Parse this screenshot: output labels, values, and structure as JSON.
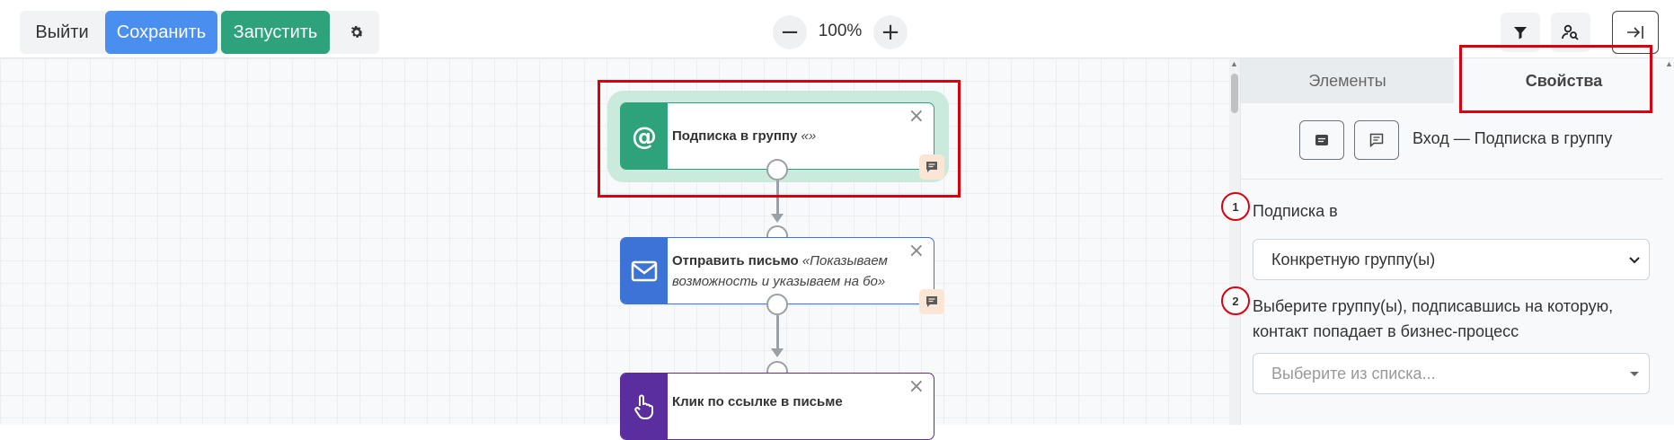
{
  "toolbar": {
    "exit_label": "Выйти",
    "save_label": "Сохранить",
    "run_label": "Запустить",
    "zoom_minus": "−",
    "zoom_plus": "+",
    "zoom_level": "100%"
  },
  "nodes": [
    {
      "title": "Подписка в группу",
      "subtitle": "«»",
      "icon": "at-icon",
      "color": "#2ea27a"
    },
    {
      "title": "Отправить письмо",
      "subtitle": "«Показываем возможность и указываем на бо»",
      "icon": "envelope-icon",
      "color": "#3d72d6"
    },
    {
      "title": "Клик по ссылке в письме",
      "subtitle": "",
      "icon": "pointer-hand-icon",
      "color": "#5b2ea0"
    }
  ],
  "panel": {
    "tabs": [
      {
        "label": "Элементы"
      },
      {
        "label": "Свойства"
      }
    ],
    "title": "Вход — Подписка в группу",
    "fields": [
      {
        "number": "1",
        "label": "Подписка в",
        "value": "Конкретную группу(ы)"
      },
      {
        "number": "2",
        "label": "Выберите группу(ы), подписавшись на которую, контакт попадает в бизнес-процесс",
        "placeholder": "Выберите из списка..."
      }
    ]
  },
  "colors": {
    "save": "#4a8ef0",
    "run": "#2ea27a",
    "highlight": "#d90010",
    "node_selected_glow": "#c9eadd"
  }
}
